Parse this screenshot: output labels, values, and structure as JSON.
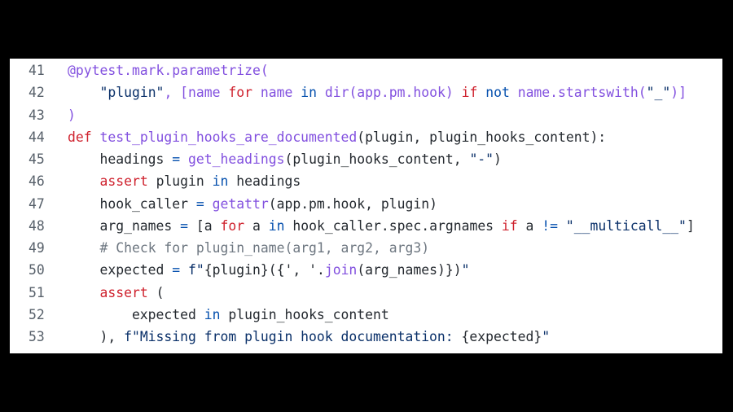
{
  "colors": {
    "background": "#000000",
    "panel": "#ffffff",
    "line_number": "#57606a",
    "keyword": "#cf222e",
    "operator": "#0550ae",
    "function": "#8250df",
    "string": "#0a3069",
    "comment": "#6e7781",
    "text": "#24292f"
  },
  "code": {
    "language": "python",
    "lines": [
      {
        "number": "41",
        "tokens": [
          {
            "t": "@pytest.mark.parametrize(",
            "c": "fn"
          }
        ]
      },
      {
        "number": "42",
        "tokens": [
          {
            "t": "    ",
            "c": "tx"
          },
          {
            "t": "\"plugin\"",
            "c": "str"
          },
          {
            "t": ", [name ",
            "c": "fn"
          },
          {
            "t": "for",
            "c": "kw"
          },
          {
            "t": " name ",
            "c": "fn"
          },
          {
            "t": "in",
            "c": "op"
          },
          {
            "t": " dir(app.pm.hook) ",
            "c": "fn"
          },
          {
            "t": "if",
            "c": "kw"
          },
          {
            "t": " ",
            "c": "fn"
          },
          {
            "t": "not",
            "c": "op"
          },
          {
            "t": " name.startswith(",
            "c": "fn"
          },
          {
            "t": "\"_\"",
            "c": "str"
          },
          {
            "t": ")]",
            "c": "fn"
          }
        ]
      },
      {
        "number": "43",
        "tokens": [
          {
            "t": ")",
            "c": "fn"
          }
        ]
      },
      {
        "number": "44",
        "tokens": [
          {
            "t": "def",
            "c": "kw"
          },
          {
            "t": " ",
            "c": "tx"
          },
          {
            "t": "test_plugin_hooks_are_documented",
            "c": "fn"
          },
          {
            "t": "(plugin, plugin_hooks_content):",
            "c": "tx"
          }
        ]
      },
      {
        "number": "45",
        "tokens": [
          {
            "t": "    headings ",
            "c": "tx"
          },
          {
            "t": "=",
            "c": "op"
          },
          {
            "t": " ",
            "c": "tx"
          },
          {
            "t": "get_headings",
            "c": "fn"
          },
          {
            "t": "(plugin_hooks_content, ",
            "c": "tx"
          },
          {
            "t": "\"-\"",
            "c": "str"
          },
          {
            "t": ")",
            "c": "tx"
          }
        ]
      },
      {
        "number": "46",
        "tokens": [
          {
            "t": "    ",
            "c": "tx"
          },
          {
            "t": "assert",
            "c": "kw"
          },
          {
            "t": " plugin ",
            "c": "tx"
          },
          {
            "t": "in",
            "c": "op"
          },
          {
            "t": " headings",
            "c": "tx"
          }
        ]
      },
      {
        "number": "47",
        "tokens": [
          {
            "t": "    hook_caller ",
            "c": "tx"
          },
          {
            "t": "=",
            "c": "op"
          },
          {
            "t": " ",
            "c": "tx"
          },
          {
            "t": "getattr",
            "c": "fn"
          },
          {
            "t": "(app.pm.hook, plugin)",
            "c": "tx"
          }
        ]
      },
      {
        "number": "48",
        "tokens": [
          {
            "t": "    arg_names ",
            "c": "tx"
          },
          {
            "t": "=",
            "c": "op"
          },
          {
            "t": " [a ",
            "c": "tx"
          },
          {
            "t": "for",
            "c": "kw"
          },
          {
            "t": " a ",
            "c": "tx"
          },
          {
            "t": "in",
            "c": "op"
          },
          {
            "t": " hook_caller.spec.argnames ",
            "c": "tx"
          },
          {
            "t": "if",
            "c": "kw"
          },
          {
            "t": " a ",
            "c": "tx"
          },
          {
            "t": "!=",
            "c": "op"
          },
          {
            "t": " ",
            "c": "tx"
          },
          {
            "t": "\"__multicall__\"",
            "c": "str"
          },
          {
            "t": "]",
            "c": "tx"
          }
        ]
      },
      {
        "number": "49",
        "tokens": [
          {
            "t": "    ",
            "c": "tx"
          },
          {
            "t": "# Check for plugin_name(arg1, arg2, arg3)",
            "c": "cm"
          }
        ]
      },
      {
        "number": "50",
        "tokens": [
          {
            "t": "    expected ",
            "c": "tx"
          },
          {
            "t": "=",
            "c": "op"
          },
          {
            "t": " ",
            "c": "tx"
          },
          {
            "t": "f\"",
            "c": "str"
          },
          {
            "t": "{plugin}({', '.",
            "c": "tx"
          },
          {
            "t": "join",
            "c": "fn"
          },
          {
            "t": "(arg_names)})",
            "c": "tx"
          },
          {
            "t": "\"",
            "c": "str"
          }
        ]
      },
      {
        "number": "51",
        "tokens": [
          {
            "t": "    ",
            "c": "tx"
          },
          {
            "t": "assert",
            "c": "kw"
          },
          {
            "t": " (",
            "c": "tx"
          }
        ]
      },
      {
        "number": "52",
        "tokens": [
          {
            "t": "        expected ",
            "c": "tx"
          },
          {
            "t": "in",
            "c": "op"
          },
          {
            "t": " plugin_hooks_content",
            "c": "tx"
          }
        ]
      },
      {
        "number": "53",
        "tokens": [
          {
            "t": "    ), ",
            "c": "tx"
          },
          {
            "t": "f\"Missing from plugin hook documentation: ",
            "c": "str"
          },
          {
            "t": "{expected}",
            "c": "tx"
          },
          {
            "t": "\"",
            "c": "str"
          }
        ]
      }
    ]
  }
}
